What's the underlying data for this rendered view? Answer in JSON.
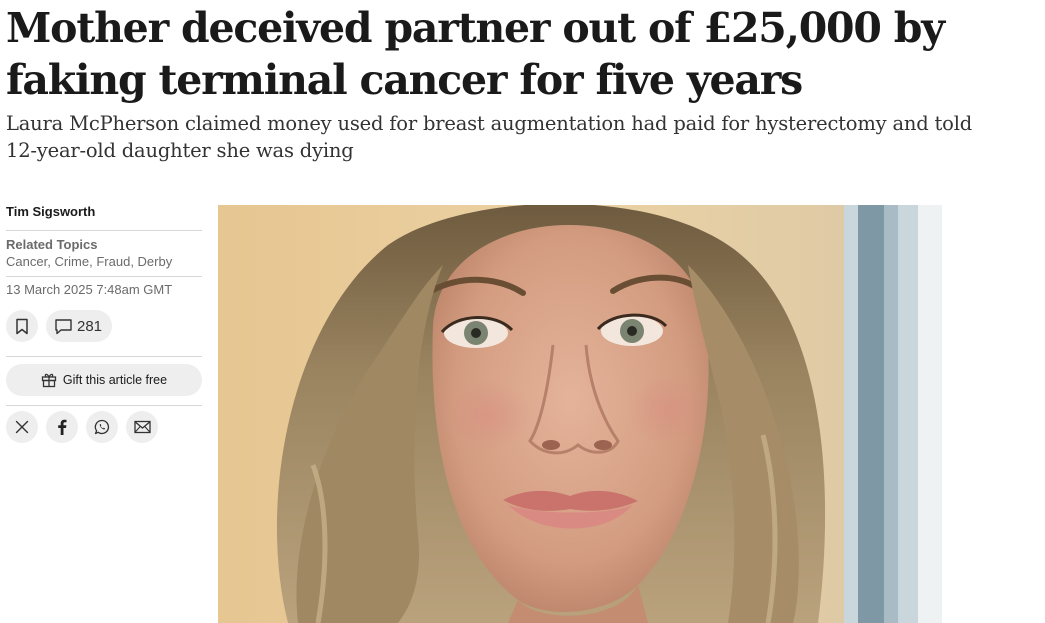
{
  "article": {
    "headline": "Mother deceived partner out of £25,000 by faking terminal cancer for five years",
    "standfirst": "Laura McPherson claimed money used for breast augmentation had paid for hysterectomy and told 12-year-old daughter she was dying"
  },
  "sidebar": {
    "author": "Tim Sigsworth",
    "related_heading": "Related Topics",
    "topics": [
      "Cancer",
      "Crime",
      "Fraud",
      "Derby"
    ],
    "topic_separator": ", ",
    "timestamp": "13 March 2025 7:48am GMT",
    "comment_count": "281",
    "gift_label": "Gift this article free",
    "share_icons": [
      "x-icon",
      "facebook-icon",
      "whatsapp-icon",
      "email-icon"
    ],
    "bookmark_icon": "bookmark-icon",
    "comment_icon": "comment-icon",
    "gift_icon": "gift-icon"
  },
  "colors": {
    "text": "#1a1a1a",
    "muted": "#6b6b6b",
    "button_bg": "#eeeeee",
    "divider": "#d8d8d8"
  }
}
